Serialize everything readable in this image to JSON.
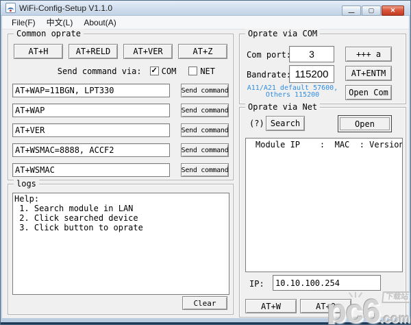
{
  "window": {
    "title": "WiFi-Config-Setup V1.1.0",
    "minimize_glyph": "—",
    "maximize_glyph": "▢",
    "close_glyph": "✕"
  },
  "menu": {
    "items": [
      "File(F)",
      "中文(L)",
      "About(A)"
    ]
  },
  "common_oprate": {
    "title": "Common oprate",
    "quick_buttons": [
      "AT+H",
      "AT+RELD",
      "AT+VER",
      "AT+Z"
    ],
    "send_via_label": "Send command via:",
    "com_checkbox": {
      "label": "COM",
      "checked": true,
      "mark": "✓"
    },
    "net_checkbox": {
      "label": "NET",
      "checked": false,
      "mark": ""
    },
    "send_button_label": "Send command",
    "commands": [
      "AT+WAP=11BGN, LPT330",
      "AT+WAP",
      "AT+VER",
      "AT+WSMAC=8888, ACCF2",
      "AT+WSMAC"
    ]
  },
  "logs": {
    "title": "logs",
    "content": "Help:\n 1. Search module in LAN\n 2. Click searched device\n 3. Click button to oprate",
    "clear_label": "Clear"
  },
  "com_group": {
    "title": "Oprate via COM",
    "com_port_label": "Com port:",
    "com_port_value": "3",
    "escape_button": "+++ a",
    "bandrate_label": "Bandrate:",
    "bandrate_value": "115200",
    "entm_button": "AT+ENTM",
    "hint_line1": "A11/A21 default 57600,",
    "hint_line2": "Others 115200",
    "hint_color": "#2e8ce0",
    "open_com_button": "Open Com"
  },
  "net_group": {
    "title": "Oprate via Net",
    "help_mark": "(?)",
    "search_button": "Search",
    "open_button": "Open",
    "list_header": "Module IP    :  MAC  : Version",
    "ip_label": "IP:",
    "ip_value": "10.10.100.254",
    "atw_button": "AT+W",
    "atq_button": "AT+Q"
  },
  "watermark": {
    "text": "pc6",
    "suffix": ".com",
    "badge": "下载站"
  }
}
